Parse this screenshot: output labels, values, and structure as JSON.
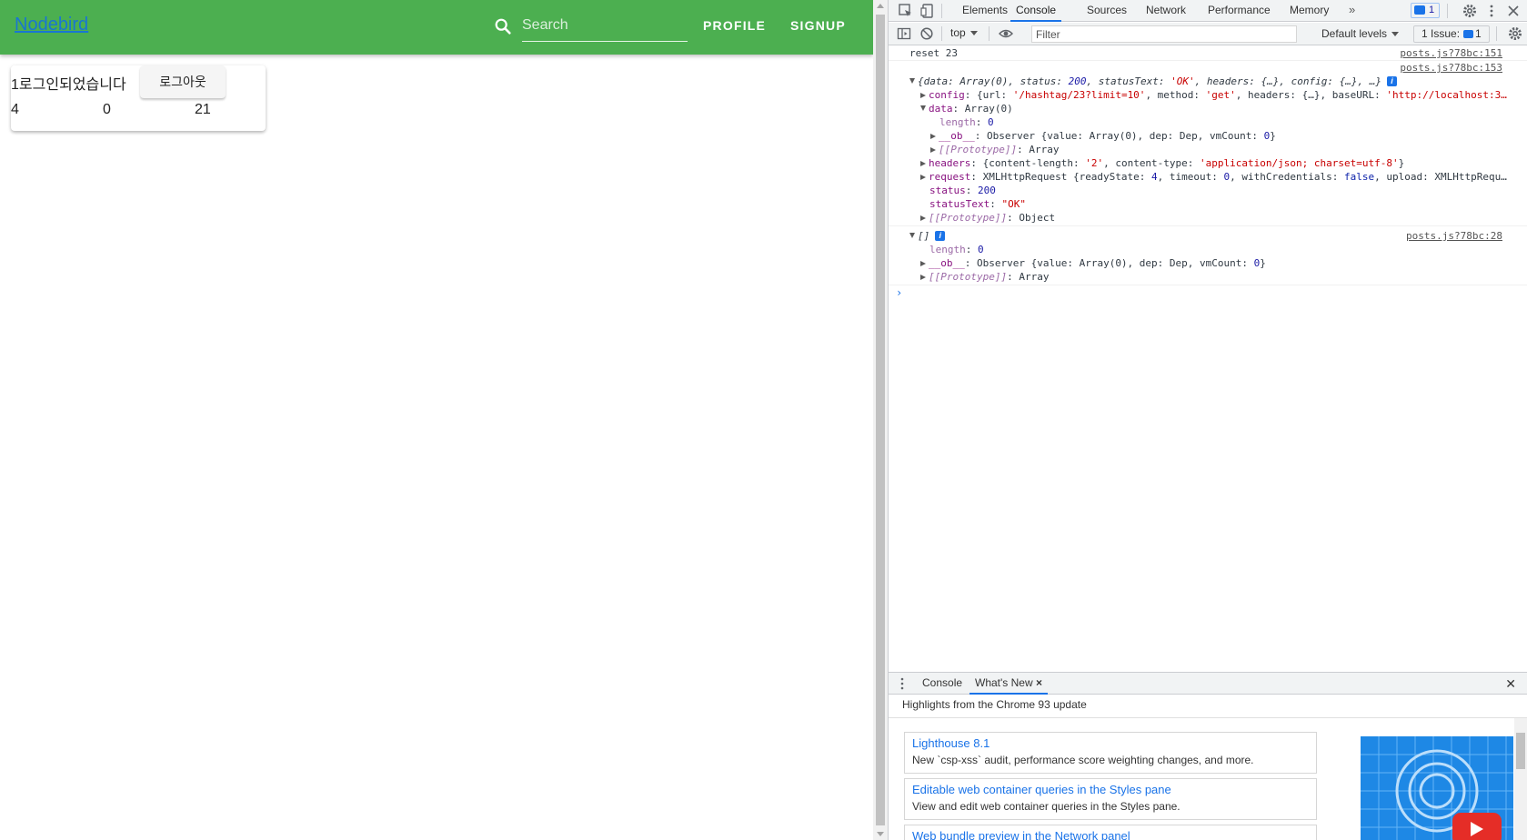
{
  "app": {
    "brand": "Nodebird",
    "search": {
      "placeholder": "Search",
      "value": ""
    },
    "nav": {
      "profile": "PROFILE",
      "signup": "SIGNUP"
    },
    "card": {
      "message": "1로그인되었습니다",
      "logout_label": "로그아웃",
      "stats": [
        "4",
        "0",
        "21"
      ]
    },
    "colors": {
      "appbar": "#4caf50",
      "brand_link": "#1976d2"
    }
  },
  "devtools": {
    "tabs": [
      "Elements",
      "Console",
      "Sources",
      "Network",
      "Performance",
      "Memory"
    ],
    "active_tab": "Console",
    "more_tabs": "»",
    "issue_chip_count": "1",
    "toolbar": {
      "context": "top",
      "filter_placeholder": "Filter",
      "levels": "Default levels",
      "issues_label": "1 Issue:",
      "issues_count": "1"
    },
    "console": {
      "reset_text": "reset 23",
      "src_151": "posts.js?78bc:151",
      "src_153": "posts.js?78bc:153",
      "src_28": "posts.js?78bc:28",
      "obj_summary_pre": "{data: Array(0), status: ",
      "obj_summary_status": "200",
      "obj_summary_mid": ", statusText: ",
      "obj_summary_statustext": "'OK'",
      "obj_summary_post": ", headers: {…}, config: {…}, …}",
      "config_key": "config",
      "config_pre": ": {url: ",
      "config_url": "'/hashtag/23?limit=10'",
      "config_mid": ", method: ",
      "config_method": "'get'",
      "config_mid2": ", headers: {…}, baseURL: ",
      "config_base": "'http://localhost:3…",
      "data_key": "data",
      "data_val": ": Array(0)",
      "length_key": "length",
      "length_val": "0",
      "ob_key": "__ob__",
      "ob_pre": ": Observer {value: Array(0), dep: Dep, vmCount: ",
      "ob_num": "0",
      "ob_post": "}",
      "proto_key": "[[Prototype]]",
      "proto_array": ": Array",
      "proto_object": ": Object",
      "headers_key": "headers",
      "headers_pre": ": {content-length: ",
      "headers_len": "'2'",
      "headers_mid": ", content-type: ",
      "headers_ct": "'application/json; charset=utf-8'",
      "headers_post": "}",
      "request_key": "request",
      "request_pre": ": XMLHttpRequest {readyState: ",
      "request_rs": "4",
      "request_mid": ", timeout: ",
      "request_to": "0",
      "request_mid2": ", withCredentials: ",
      "request_wc": "false",
      "request_post": ", upload: XMLHttpRequ…",
      "status_key": "status",
      "status_val": "200",
      "statustext_key": "statusText",
      "statustext_val": "\"OK\"",
      "array_summary": "[]",
      "info_glyph": "i",
      "prompt": "›"
    },
    "drawer": {
      "tabs": [
        "Console",
        "What's New"
      ],
      "close_tab_glyph": "×",
      "close_glyph": "✕",
      "highlights": "Highlights from the Chrome 93 update",
      "features": [
        {
          "title": "Lighthouse 8.1",
          "desc": "New `csp-xss` audit, performance score weighting changes, and more."
        },
        {
          "title": "Editable web container queries in the Styles pane",
          "desc": "View and edit web container queries in the Styles pane."
        },
        {
          "title": "Web bundle preview in the Network panel",
          "desc": ""
        }
      ]
    },
    "colors": {
      "accent": "#1a73e8",
      "string": "#c80000",
      "number": "#1a1aa6",
      "keyword": "#881280"
    }
  }
}
